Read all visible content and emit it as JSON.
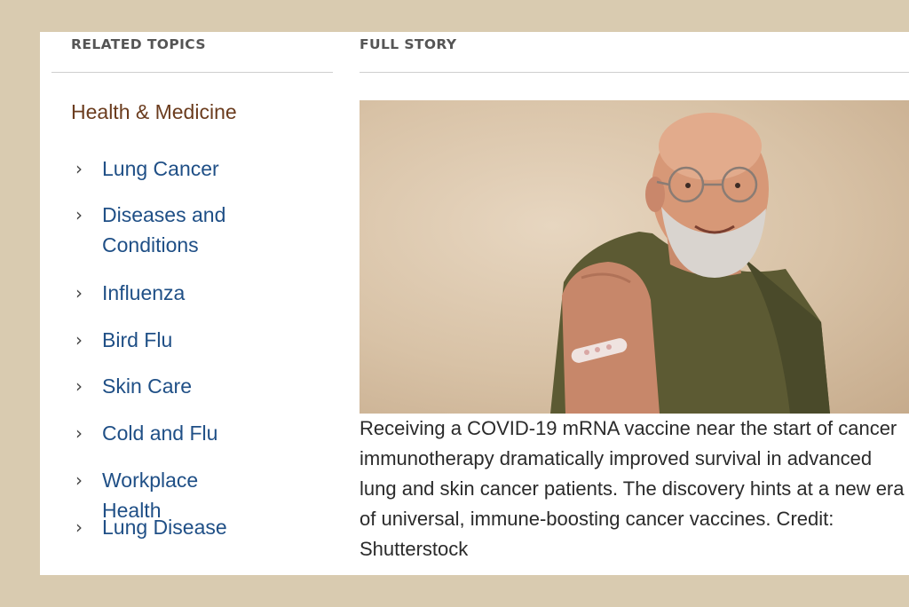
{
  "related": {
    "heading": "RELATED TOPICS",
    "category": "Health & Medicine",
    "topics": [
      "Lung Cancer",
      "Diseases and Conditions",
      "Influenza",
      "Bird Flu",
      "Skin Care",
      "Cold and Flu",
      "Workplace Health",
      "Lung Disease"
    ]
  },
  "story": {
    "heading": "FULL STORY",
    "caption": "Receiving a COVID-19 mRNA vaccine near the start of cancer immunotherapy dramatically improved survival in advanced lung and skin cancer patients. The discovery hints at a new era of universal, immune-boosting cancer vaccines. Credit: Shutterstock"
  },
  "icons": {
    "topic_bullet": "chevron-right-icon"
  },
  "colors": {
    "frame": "#d9cbb0",
    "link": "#1f4f86",
    "category": "#6b3c1e",
    "heading": "#555555"
  }
}
